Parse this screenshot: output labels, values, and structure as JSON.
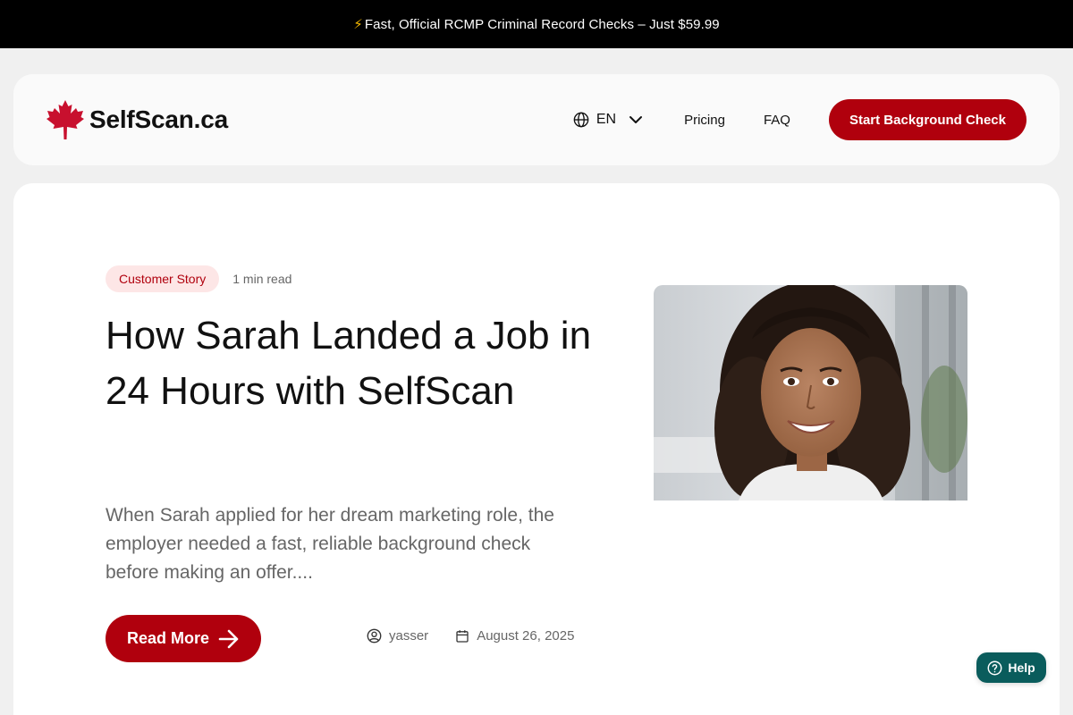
{
  "announcement": {
    "icon": "lightning-icon",
    "bolt": "⚡",
    "text": "Fast, Official RCMP Criminal Record Checks – Just $59.99"
  },
  "header": {
    "logo_icon": "maple-leaf-icon",
    "logo_text": "SelfScan.ca",
    "language": "EN",
    "nav": {
      "pricing": "Pricing",
      "faq": "FAQ"
    },
    "cta": "Start Background Check"
  },
  "post": {
    "category": "Customer Story",
    "read_time": "1 min read",
    "title": "How Sarah Landed a Job in 24 Hours with SelfScan",
    "excerpt": "When Sarah applied for her dream marketing role, the employer needed a fast, reliable background check before making an offer....",
    "read_more": "Read More",
    "author": "yasser",
    "date": "August 26, 2025"
  },
  "help": {
    "label": "Help"
  },
  "colors": {
    "brand_red": "#b0000d",
    "badge_bg": "#fde6e6",
    "help_teal": "#0a5c5c",
    "announcement_bg": "#000000"
  }
}
